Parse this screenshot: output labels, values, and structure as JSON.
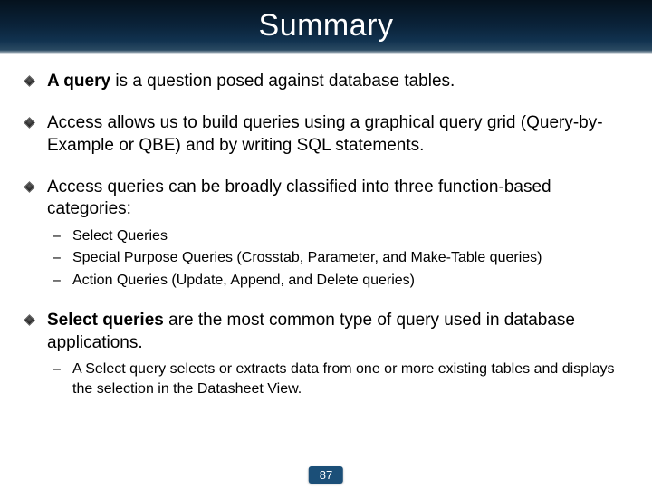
{
  "title": "Summary",
  "bullets": [
    {
      "type": "main",
      "prefix_bold": "A query",
      "rest": " is a question posed against database tables."
    },
    {
      "type": "main",
      "text": "Access allows us to build queries using a graphical query grid (Query-by-Example or QBE) and by writing SQL statements."
    },
    {
      "type": "main_with_sub",
      "text": "Access queries can be broadly classified into three function-based categories:",
      "sub": [
        "Select Queries",
        "Special Purpose Queries (Crosstab, Parameter, and Make-Table queries)",
        "Action Queries (Update, Append, and Delete queries)"
      ]
    },
    {
      "type": "main_bold_with_sub",
      "prefix_bold": "Select queries",
      "rest": " are the most common type of query used in database applications.",
      "sub": [
        "A Select query selects or extracts data from one or more existing tables and displays the selection in the Datasheet View."
      ]
    }
  ],
  "dash": "–",
  "slide_number": "87"
}
